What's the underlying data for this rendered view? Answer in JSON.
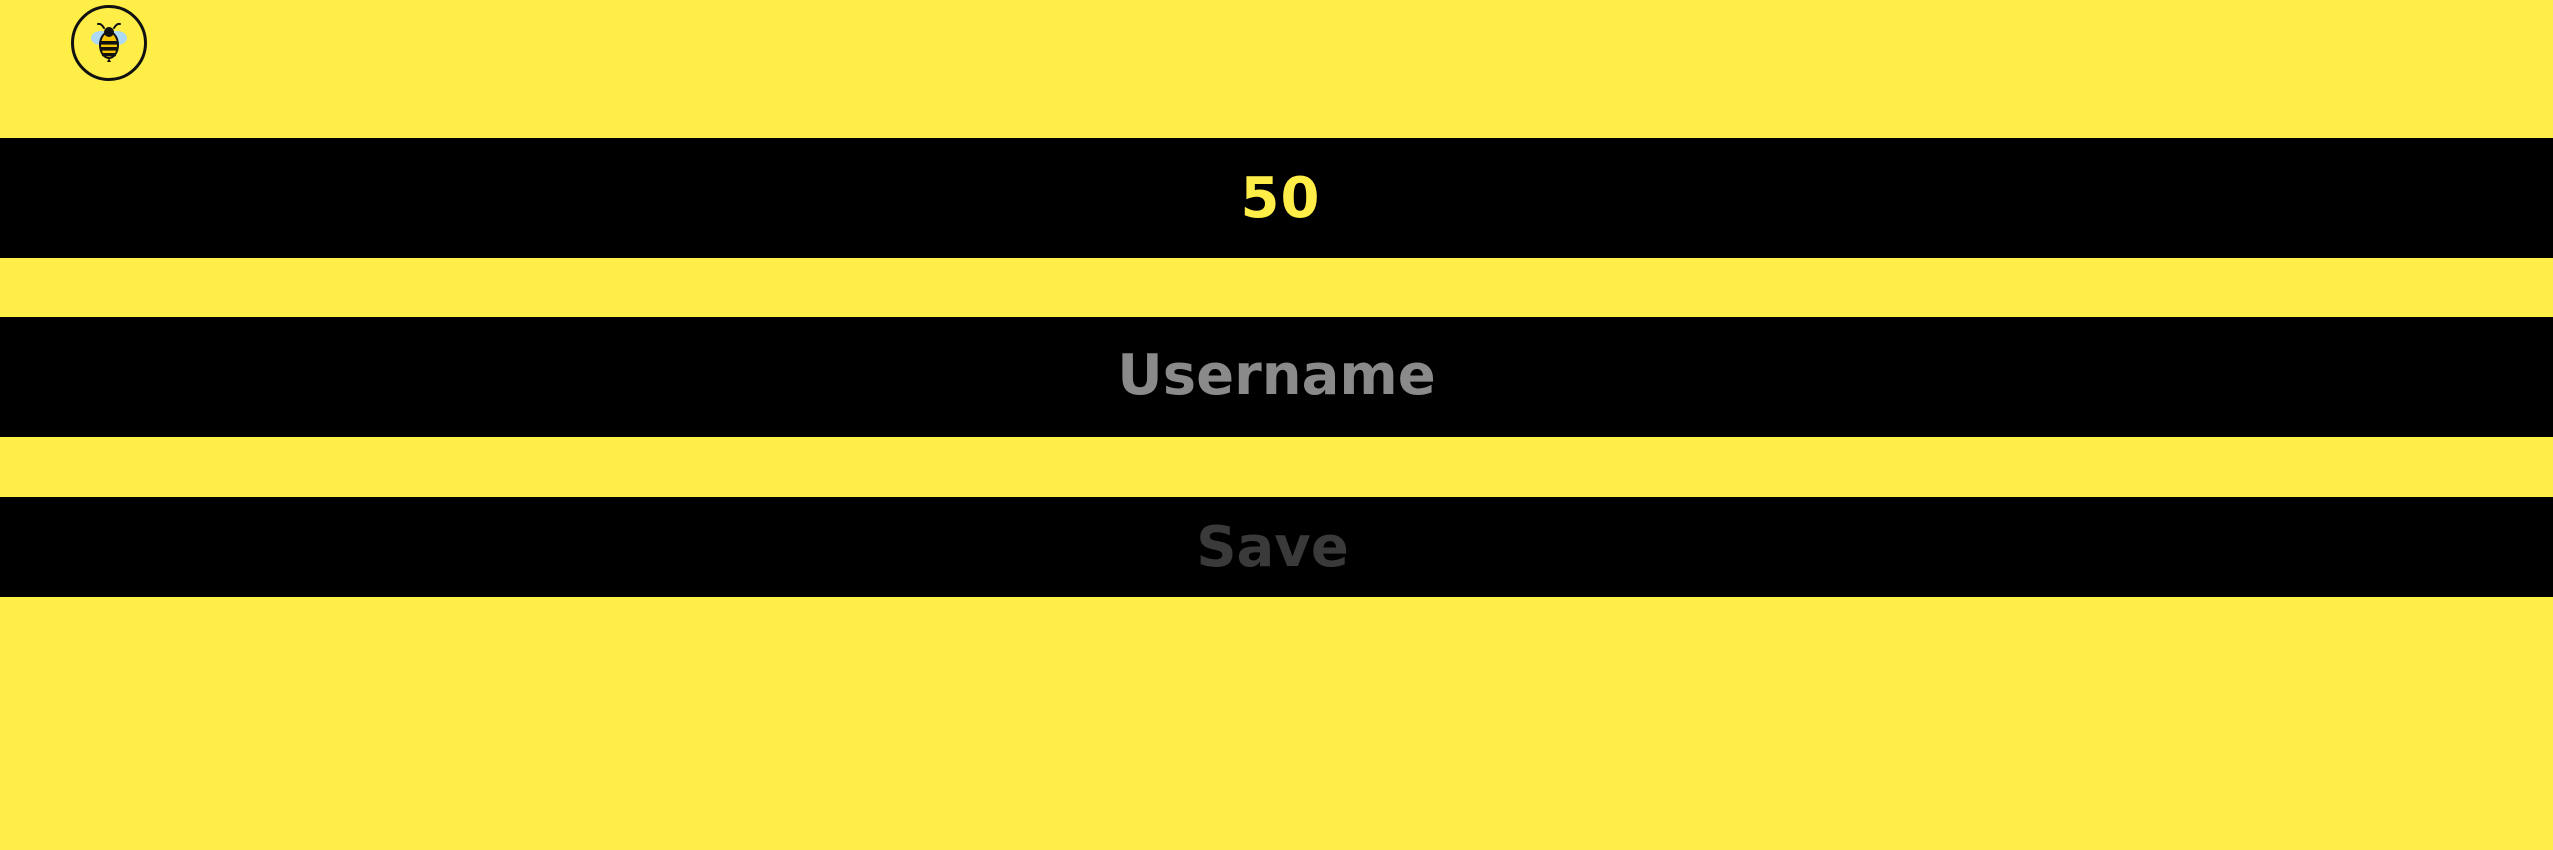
{
  "app": {
    "logo_icon": "bee-icon"
  },
  "score": {
    "value": "50"
  },
  "username": {
    "value": "",
    "placeholder": "Username"
  },
  "actions": {
    "save_label": "Save"
  },
  "colors": {
    "background": "#FFEE47",
    "band": "#000000",
    "score_text": "#FFEE47",
    "placeholder_text": "#8A8A8A",
    "disabled_text": "#3A3A3A",
    "logo_border": "#111111"
  }
}
